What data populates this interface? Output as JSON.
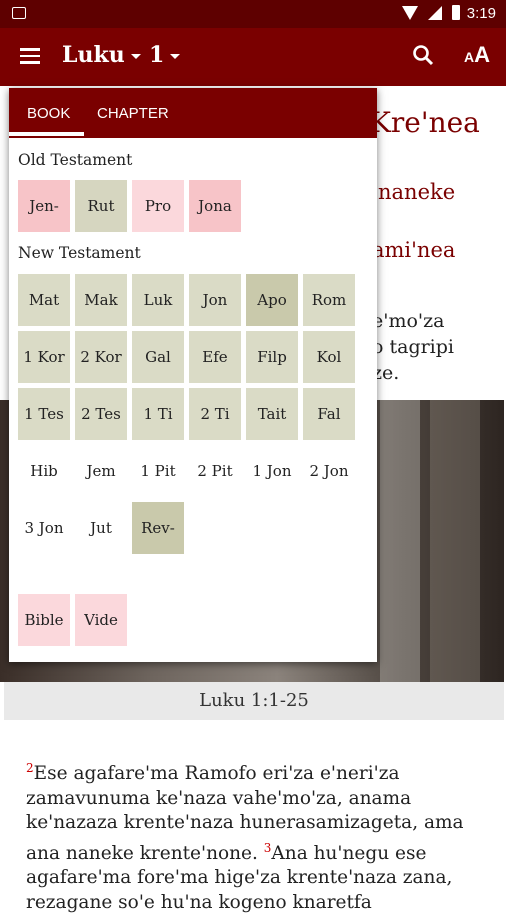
{
  "status": {
    "time": "3:19"
  },
  "appbar": {
    "book": "Luku",
    "chapter": "1"
  },
  "background": {
    "title_fragment": "Kre'nea",
    "heading1_fragment": "naneke",
    "heading2_fragment": "ami'nea",
    "lines": [
      "e'mo'za",
      "o tagripi",
      "ze."
    ],
    "caption": "Luku 1:1-25",
    "verse_num1": "2",
    "verse_text1": "Ese agafare'ma Ramofo eri'za e'neri'za zamavunuma ke'naza vahe'mo'za, anama ke'nazaza krente'naza hunerasamizageta, ama ana naneke krente'none.",
    "verse_num2": "3",
    "verse_text2": "Ana hu'negu ese agafare'ma fore'ma hige'za krente'naza zana, rezagane so'e hu'na kogeno knaretfa"
  },
  "popup": {
    "tab_book": "BOOK",
    "tab_chapter": "CHAPTER",
    "old_testament": "Old Testament",
    "new_testament": "New Testament",
    "ot_books": [
      "Jen-",
      "Rut",
      "Pro",
      "Jona"
    ],
    "nt_books": [
      "Mat",
      "Mak",
      "Luk",
      "Jon",
      "Apo",
      "Rom",
      "1 Kor",
      "2 Kor",
      "Gal",
      "Efe",
      "Filp",
      "Kol",
      "1 Tes",
      "2 Tes",
      "1 Ti",
      "2 Ti",
      "Tait",
      "Fal",
      "Hib",
      "Jem",
      "1 Pit",
      "2 Pit",
      "1 Jon",
      "2 Jon",
      "3 Jon",
      "Jut",
      "Rev-"
    ],
    "extras": [
      "Bible",
      "Vide"
    ]
  }
}
